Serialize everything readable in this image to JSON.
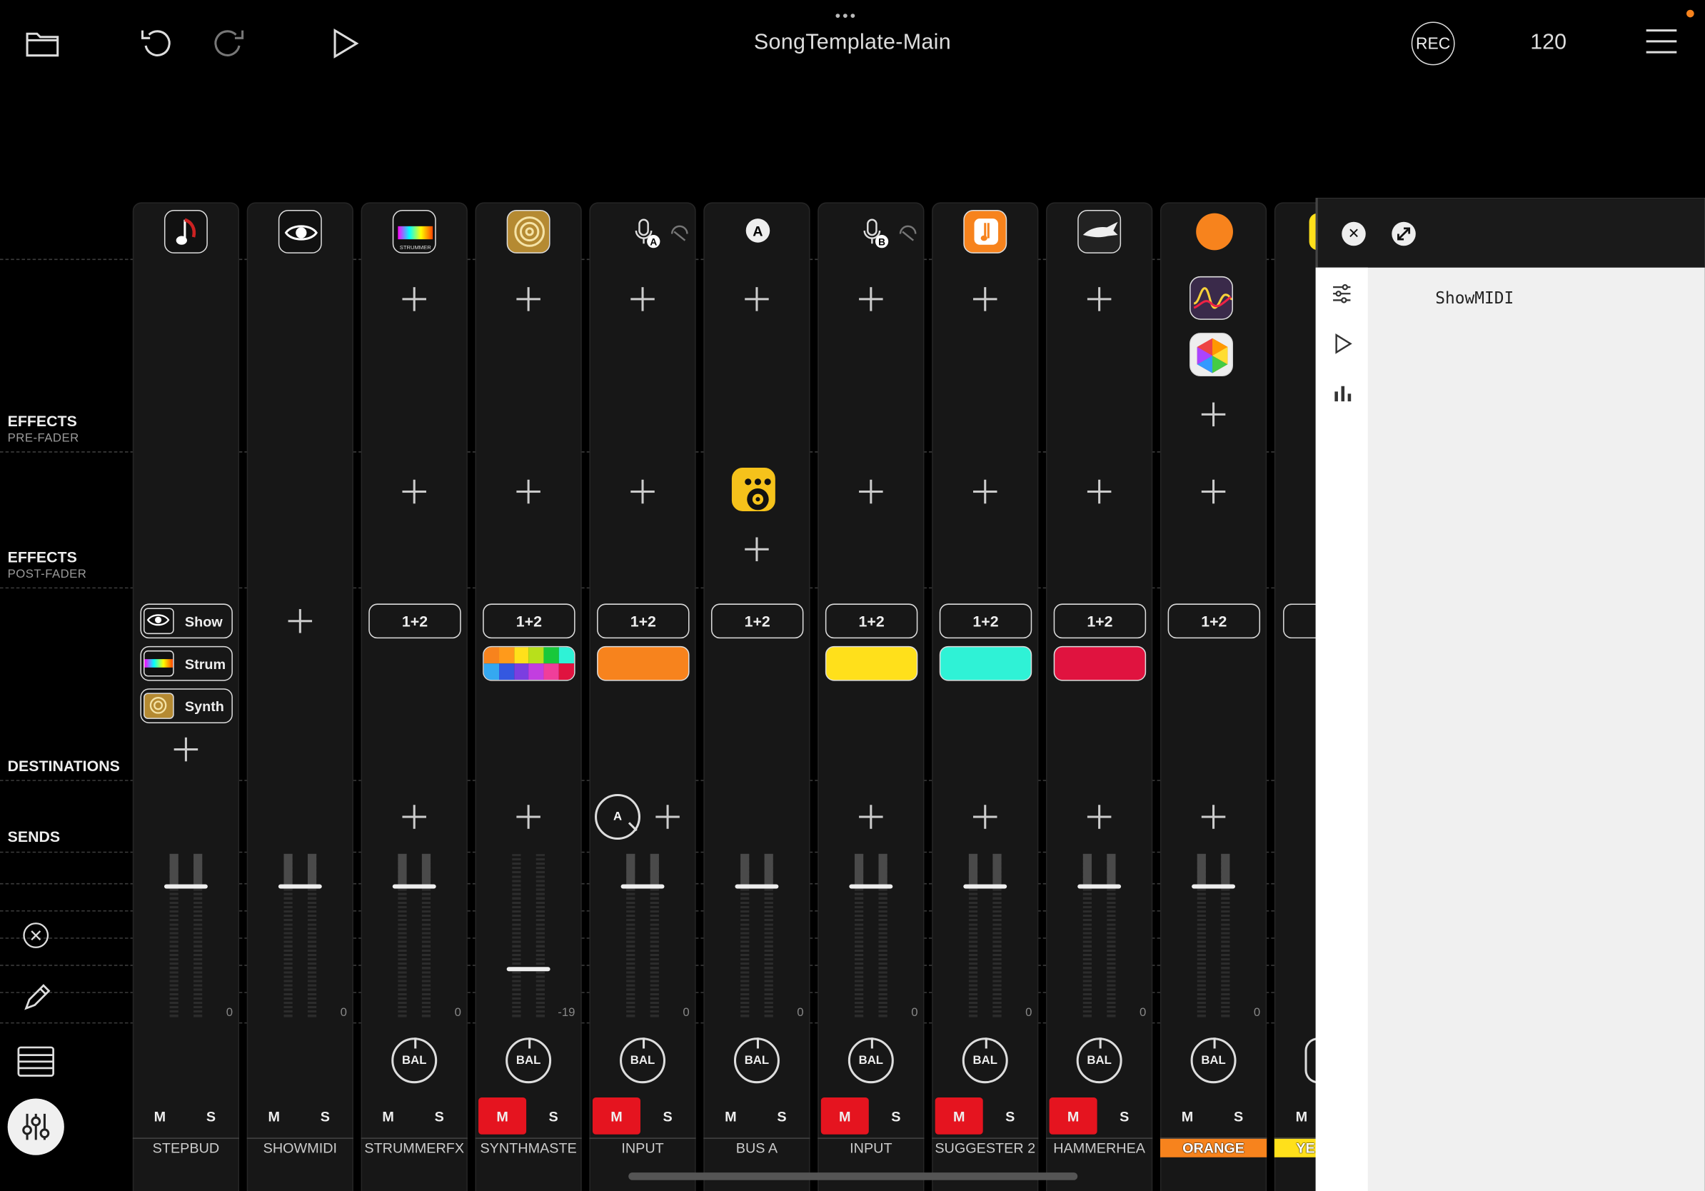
{
  "app": {
    "title": "SongTemplate-Main",
    "rec_label": "REC",
    "tempo": "120"
  },
  "sections": {
    "effects_pre": {
      "label": "EFFECTS",
      "sub": "PRE-FADER"
    },
    "effects_post": {
      "label": "EFFECTS",
      "sub": "POST-FADER"
    },
    "destinations": {
      "label": "DESTINATIONS"
    },
    "sends": {
      "label": "SENDS"
    }
  },
  "channels": [
    {
      "name": "STEPBUD",
      "db": "0",
      "mute": false,
      "solo": "S",
      "mute_label": "M"
    },
    {
      "name": "SHOWMIDI",
      "db": "0",
      "mute": false,
      "solo": "S",
      "mute_label": "M"
    },
    {
      "name": "STRUMMERFX",
      "db": "0",
      "mute": false,
      "solo": "S",
      "mute_label": "M",
      "bal": "BAL",
      "dest": "1+2"
    },
    {
      "name": "SYNTHMASTE",
      "db": "-19",
      "mute": true,
      "solo": "S",
      "mute_label": "M",
      "bal": "BAL",
      "dest": "1+2"
    },
    {
      "name": "INPUT",
      "db": "0",
      "mute": true,
      "solo": "S",
      "mute_label": "M",
      "bal": "BAL",
      "dest": "1+2",
      "send": "A"
    },
    {
      "name": "BUS A",
      "db": "0",
      "mute": false,
      "solo": "S",
      "mute_label": "M",
      "bal": "BAL",
      "dest": "1+2",
      "bus": "A"
    },
    {
      "name": "INPUT",
      "db": "0",
      "mute": true,
      "solo": "S",
      "mute_label": "M",
      "bal": "BAL",
      "dest": "1+2"
    },
    {
      "name": "SUGGESTER 2",
      "db": "0",
      "mute": true,
      "solo": "S",
      "mute_label": "M",
      "bal": "BAL",
      "dest": "1+2"
    },
    {
      "name": "HAMMERHEA",
      "db": "0",
      "mute": true,
      "solo": "S",
      "mute_label": "M",
      "bal": "BAL",
      "dest": "1+2"
    },
    {
      "name": "ORANGE",
      "db": "0",
      "mute": false,
      "solo": "S",
      "mute_label": "M",
      "bal": "BAL",
      "dest": "1+2"
    },
    {
      "name": "YE",
      "mute_label": "M"
    }
  ],
  "stepbud_destinations": [
    "Show",
    "Strum",
    "Synth"
  ],
  "colors": {
    "orange": "#f7831d",
    "yellow": "#ffe01b",
    "cyan": "#2ff2d6",
    "crimson": "#e0133f",
    "mute_red": "#e5141f"
  },
  "panel": {
    "plugin_name": "ShowMIDI"
  },
  "icons": [
    "folder-icon",
    "undo-icon",
    "redo-icon",
    "play-icon",
    "menu-icon",
    "close-icon",
    "pencil-icon",
    "list-icon",
    "mixer-icon",
    "sliders-icon",
    "bar-chart-icon"
  ]
}
